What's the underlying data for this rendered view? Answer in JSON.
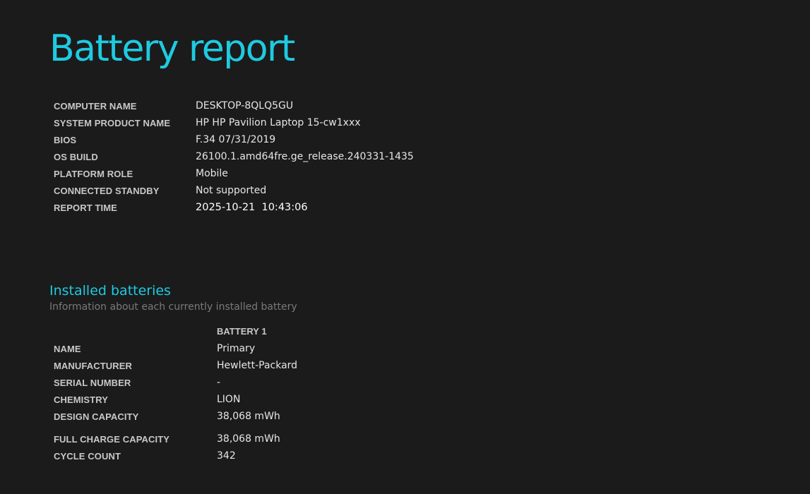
{
  "report": {
    "title": "Battery report",
    "system": [
      {
        "label": "COMPUTER NAME",
        "value": "DESKTOP-8QLQ5GU"
      },
      {
        "label": "SYSTEM PRODUCT NAME",
        "value": "HP HP Pavilion Laptop 15-cw1xxx"
      },
      {
        "label": "BIOS",
        "value": "F.34 07/31/2019"
      },
      {
        "label": "OS BUILD",
        "value": "26100.1.amd64fre.ge_release.240331-1435"
      },
      {
        "label": "PLATFORM ROLE",
        "value": "Mobile"
      },
      {
        "label": "CONNECTED STANDBY",
        "value": "Not supported"
      },
      {
        "label": "REPORT TIME",
        "value": "2025-10-21  10:43:06"
      }
    ]
  },
  "installed_batteries": {
    "title": "Installed batteries",
    "subtitle": "Information about each currently installed battery",
    "column_header": "BATTERY 1",
    "rows": [
      {
        "label": "NAME",
        "value": "Primary"
      },
      {
        "label": "MANUFACTURER",
        "value": "Hewlett-Packard"
      },
      {
        "label": "SERIAL NUMBER",
        "value": "-"
      },
      {
        "label": "CHEMISTRY",
        "value": "LION"
      },
      {
        "label": "DESIGN CAPACITY",
        "value": "38,068 mWh"
      },
      {
        "label": "FULL CHARGE CAPACITY",
        "value": "38,068 mWh"
      },
      {
        "label": "CYCLE COUNT",
        "value": "342"
      }
    ]
  },
  "colors": {
    "background": "#1b1b1b",
    "accent": "#1ecbe1",
    "label": "#c8c8c8",
    "value": "#e6e6e6",
    "subtle": "#7a7a7a"
  }
}
